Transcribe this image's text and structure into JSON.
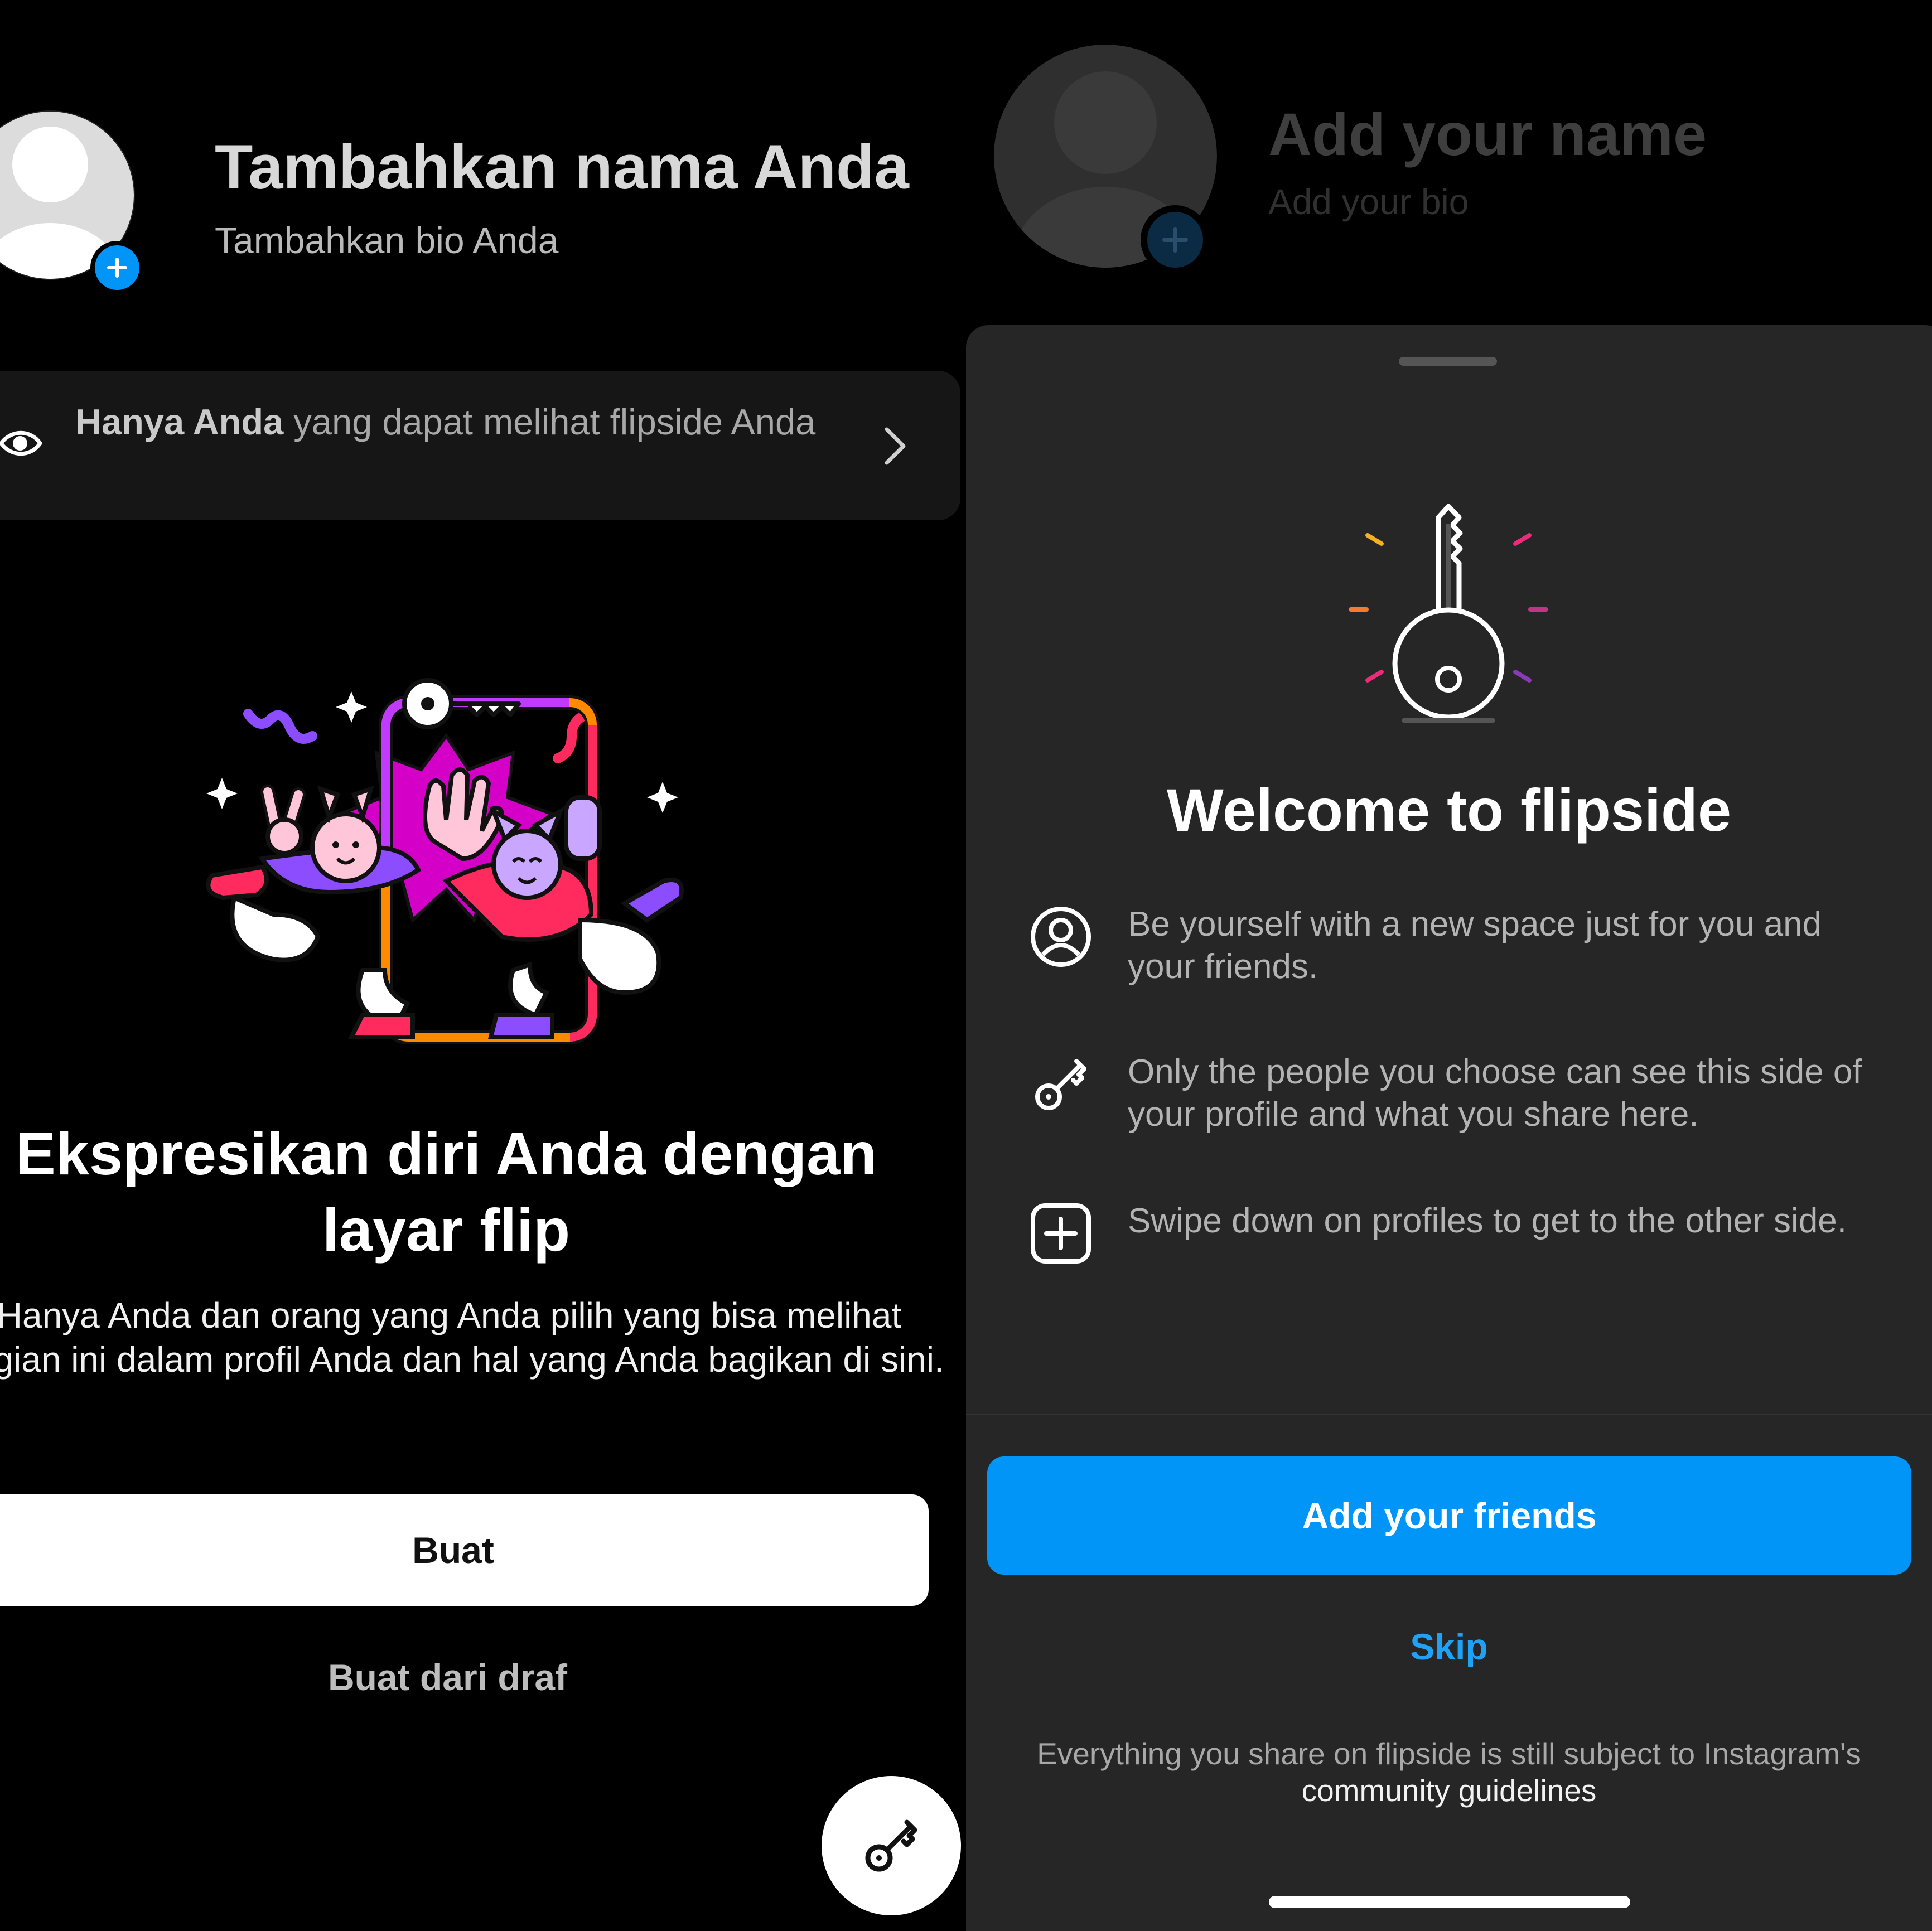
{
  "left": {
    "profile_name": "Tambahkan nama Anda",
    "profile_bio": "Tambahkan bio Anda",
    "privacy_bold": "Hanya Anda",
    "privacy_rest": " yang dapat melihat flipside Anda",
    "headline": "Ekspresikan diri Anda dengan layar flip",
    "description": "Hanya Anda dan orang yang Anda pilih yang bisa melihat bagian ini dalam profil Anda dan hal yang Anda bagikan di sini.",
    "create_button": "Buat",
    "create_from_draft": "Buat dari draf"
  },
  "right": {
    "profile_name": "Add your name",
    "profile_bio": "Add your bio",
    "welcome_title": "Welcome to flipside",
    "features": [
      {
        "icon": "person-circle-icon",
        "text": "Be yourself with a new space just for you and your friends."
      },
      {
        "icon": "key-icon",
        "text": "Only the people you choose can see this side of your profile and what you share here."
      },
      {
        "icon": "plus-square-icon",
        "text": "Swipe down on profiles to get to the other side."
      }
    ],
    "primary_button": "Add your friends",
    "skip": "Skip",
    "footer_text": "Everything you share on flipside is still subject to Instagram's",
    "footer_link": "community guidelines"
  },
  "colors": {
    "accent_blue": "#0095f6",
    "sheet_bg": "#262626",
    "page_bg": "#000000"
  }
}
